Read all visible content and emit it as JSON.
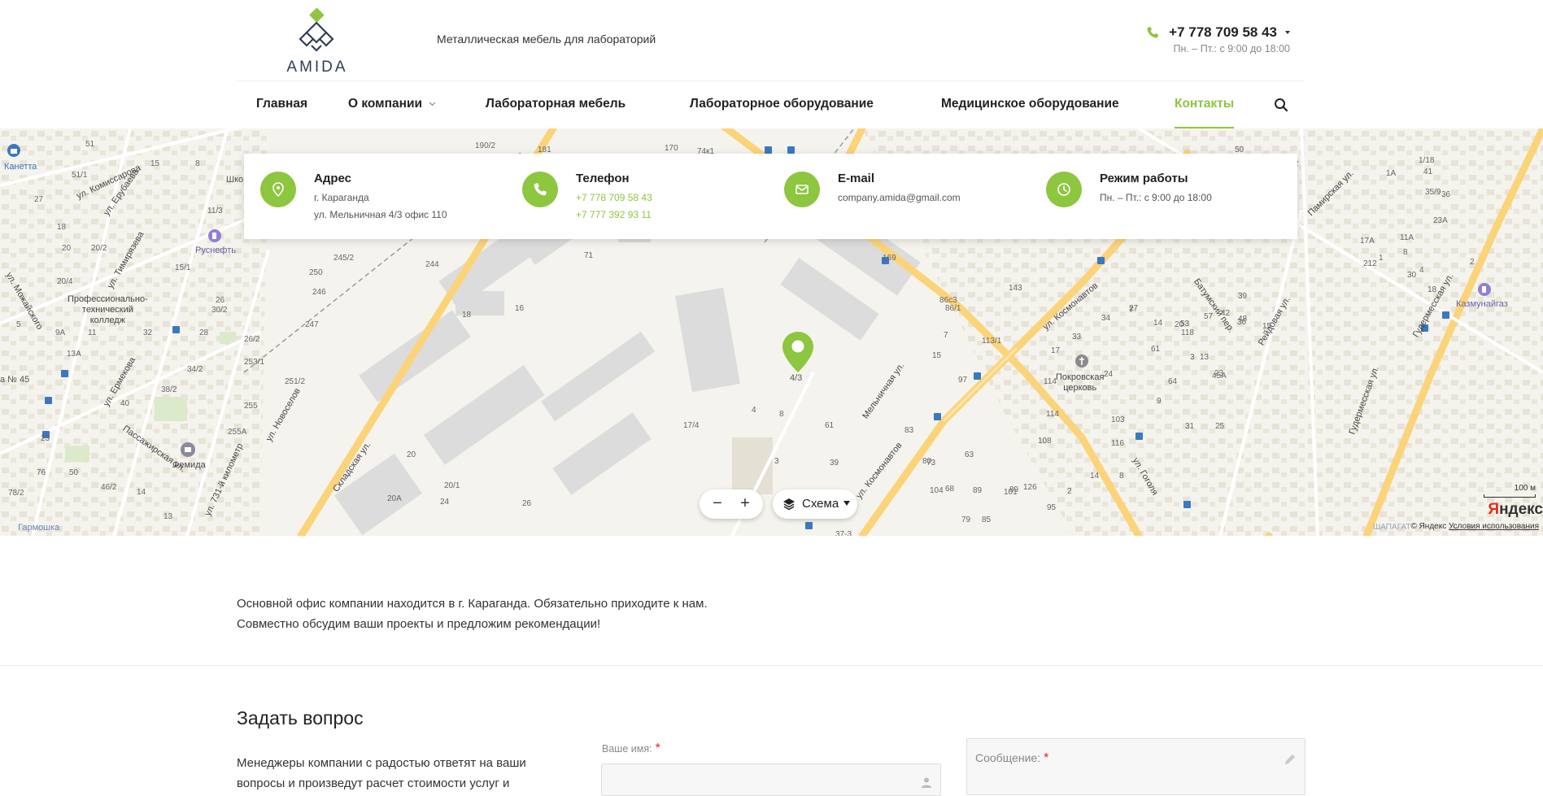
{
  "header": {
    "logo_text": "AMIDA",
    "tagline": "Металлическая мебель для лабораторий",
    "phone": "+7 778 709 58 43",
    "hours": "Пн. – Пт.: с 9:00 до 18:00",
    "accent": "#8dc63f"
  },
  "nav": {
    "items": [
      {
        "label": "Главная"
      },
      {
        "label": "О компании"
      },
      {
        "label": "Лабораторная мебель"
      },
      {
        "label": "Лабораторное оборудование"
      },
      {
        "label": "Медицинское оборудование"
      },
      {
        "label": "Контакты"
      }
    ],
    "active": "Контакты"
  },
  "contacts": {
    "address": {
      "title": "Адрес",
      "line1": "г. Караганда",
      "line2": "ул. Мельничная 4/3 офис 110",
      "icon": "location-pin-icon"
    },
    "phone": {
      "title": "Телефон",
      "line1": "+7 778 709 58 43",
      "line2": "+7 777 392 93 11",
      "icon": "phone-icon"
    },
    "email": {
      "title": "E-mail",
      "line1": "company.amida@gmail.com",
      "icon": "mail-icon"
    },
    "hours": {
      "title": "Режим работы",
      "line1": "Пн. – Пт.: с 9:00 до 18:00",
      "icon": "clock-icon"
    }
  },
  "map": {
    "scheme_label": "Схема",
    "zoom_in": "+",
    "zoom_out": "−",
    "scale_label": "100 м",
    "copyright": "© Яндекс",
    "terms": "Условия использования",
    "logo_first": "Я",
    "logo_rest": "ндекс",
    "pin_label": "4/3",
    "streets": [
      "ул. Комиссарова",
      "ул. Ерубаева",
      "ул. Тимирязева",
      "ул. Можайского",
      "ул. Ермекова",
      "ул. Новоселов",
      "Пассажирская ул.",
      "ул. 731-й километр",
      "Складская ул.",
      "Мельничная ул.",
      "ул. Космонавтов",
      "ул. Гоголя",
      "Батумский пер.",
      "Рейдовая ул.",
      "Гудермесская ул.",
      "Памирская ул."
    ],
    "pois": [
      "Канетта",
      "Руснефть",
      "Профессионально-",
      "технический",
      "колледж",
      "Фемида",
      "Покровская",
      "церковь",
      "Казмунайгаз",
      "Гармошка",
      "ШАПАГАТ",
      "Шко",
      "а № 45"
    ],
    "numbers": [
      "51",
      "15",
      "51/1",
      "8",
      "27",
      "11/3",
      "18",
      "20",
      "20/2",
      "20/4",
      "15/1",
      "26",
      "5",
      "9А",
      "11",
      "13А",
      "32",
      "30/2",
      "34/2",
      "38/2",
      "40",
      "23",
      "76",
      "50",
      "46/2",
      "78/2",
      "14",
      "13",
      "255А",
      "255",
      "251/2",
      "253/1",
      "26/2",
      "28",
      "247",
      "246",
      "250",
      "2",
      "245/2",
      "244",
      "190/2",
      "181",
      "170",
      "74к1",
      "71",
      "16",
      "18",
      "20",
      "20/1",
      "20А",
      "24",
      "26",
      "17/4",
      "4",
      "8",
      "3",
      "61",
      "39",
      "37-3",
      "50",
      "169",
      "143",
      "86/1",
      "86с3",
      "113/1",
      "7",
      "15",
      "97",
      "83",
      "80",
      "73",
      "63",
      "68",
      "104",
      "89",
      "79",
      "89",
      "101",
      "85",
      "126",
      "103",
      "116",
      "114",
      "114",
      "108",
      "95",
      "2",
      "8",
      "14",
      "17",
      "33",
      "34",
      "27",
      "24",
      "14",
      "20",
      "23",
      "118",
      "7",
      "3",
      "13",
      "9",
      "31",
      "25",
      "64",
      "61",
      "45А",
      "57",
      "48",
      "15",
      "42",
      "53",
      "39",
      "36",
      "57/2",
      "1/18",
      "1А",
      "35/9",
      "36",
      "41",
      "23А",
      "17А",
      "11А",
      "8",
      "1",
      "212",
      "2",
      "4",
      "30",
      "18"
    ]
  },
  "intro": {
    "line1": "Основной офис компании находится в г. Караганда. Обязательно приходите к нам.",
    "line2": "Совместно обсудим ваши проекты и предложим рекомендации!"
  },
  "ask": {
    "title": "Задать вопрос",
    "desc_line1": "Менеджеры компании с радостью ответят на ваши",
    "desc_line2": "вопросы и произведут расчет стоимости услуг и",
    "name_label": "Ваше имя:",
    "required_mark": "*",
    "message_label": "Сообщение:"
  }
}
